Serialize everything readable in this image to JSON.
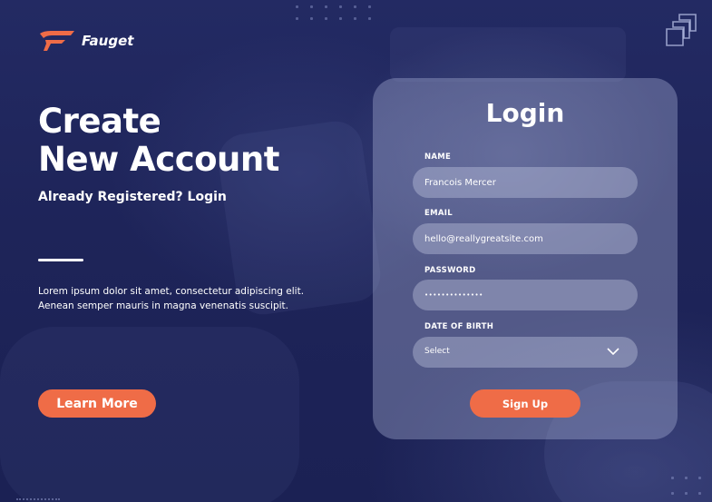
{
  "brand": {
    "name": "Fauget",
    "accent_color": "#ef6c47",
    "background_color": "#1e2459"
  },
  "hero": {
    "title_line1": "Create",
    "title_line2": "New Account",
    "subtitle": "Already Registered? Login",
    "body_line1": "Lorem ipsum dolor sit amet, consectetur adipiscing elit.",
    "body_line2": "Aenean semper mauris in magna venenatis suscipit.",
    "learn_more_label": "Learn More"
  },
  "login_card": {
    "title": "Login",
    "fields": {
      "name": {
        "label": "NAME",
        "value": "Francois Mercer"
      },
      "email": {
        "label": "EMAIL",
        "value": "hello@reallygreatsite.com"
      },
      "password": {
        "label": "PASSWORD",
        "value": "••••••••••••••"
      },
      "dob": {
        "label": "DATE OF BIRTH",
        "value": "Select"
      }
    },
    "submit_label": "Sign Up"
  },
  "icons": [
    "fauget-logo-icon",
    "stacked-squares-icon",
    "chevron-down-icon"
  ]
}
